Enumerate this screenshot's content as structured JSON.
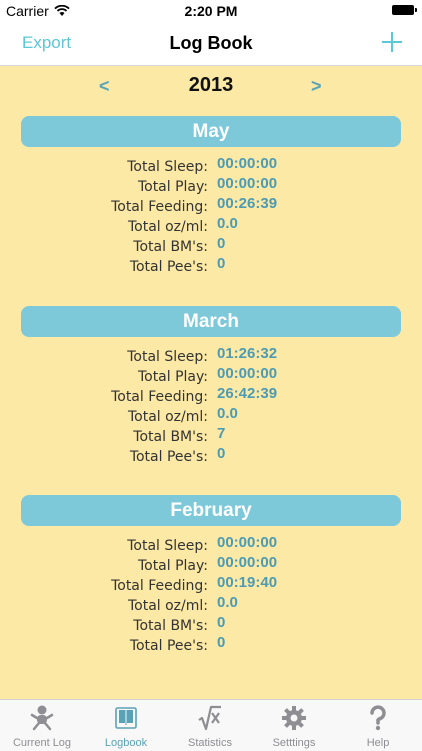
{
  "status": {
    "carrier": "Carrier",
    "time": "2:20 PM"
  },
  "nav": {
    "export_label": "Export",
    "title": "Log Book",
    "add_icon": "plus-icon"
  },
  "year_nav": {
    "prev": "<",
    "year": "2013",
    "next": ">"
  },
  "months": [
    {
      "name": "May",
      "stats": [
        {
          "label": "Total Sleep:",
          "value": "00:00:00"
        },
        {
          "label": "Total Play:",
          "value": "00:00:00"
        },
        {
          "label": "Total Feeding:",
          "value": "00:26:39"
        },
        {
          "label": "Total oz/ml:",
          "value": "0.0"
        },
        {
          "label": "Total BM's:",
          "value": "0"
        },
        {
          "label": "Total Pee's:",
          "value": "0"
        }
      ]
    },
    {
      "name": "March",
      "stats": [
        {
          "label": "Total Sleep:",
          "value": "01:26:32"
        },
        {
          "label": "Total Play:",
          "value": "00:00:00"
        },
        {
          "label": "Total Feeding:",
          "value": "26:42:39"
        },
        {
          "label": "Total oz/ml:",
          "value": "0.0"
        },
        {
          "label": "Total BM's:",
          "value": "7"
        },
        {
          "label": "Total Pee's:",
          "value": "0"
        }
      ]
    },
    {
      "name": "February",
      "stats": [
        {
          "label": "Total Sleep:",
          "value": "00:00:00"
        },
        {
          "label": "Total Play:",
          "value": "00:00:00"
        },
        {
          "label": "Total Feeding:",
          "value": "00:19:40"
        },
        {
          "label": "Total oz/ml:",
          "value": "0.0"
        },
        {
          "label": "Total BM's:",
          "value": "0"
        },
        {
          "label": "Total Pee's:",
          "value": "0"
        }
      ]
    }
  ],
  "tabs": [
    {
      "label": "Current Log",
      "icon": "baby-icon"
    },
    {
      "label": "Logbook",
      "icon": "book-icon"
    },
    {
      "label": "Statistics",
      "icon": "square-root-icon"
    },
    {
      "label": "Setttings",
      "icon": "gear-icon"
    },
    {
      "label": "Help",
      "icon": "question-icon"
    }
  ],
  "colors": {
    "background": "#fce9a6",
    "accent": "#5cc7d6",
    "month_header": "#7dc9da",
    "value_text": "#4c9bb3"
  }
}
